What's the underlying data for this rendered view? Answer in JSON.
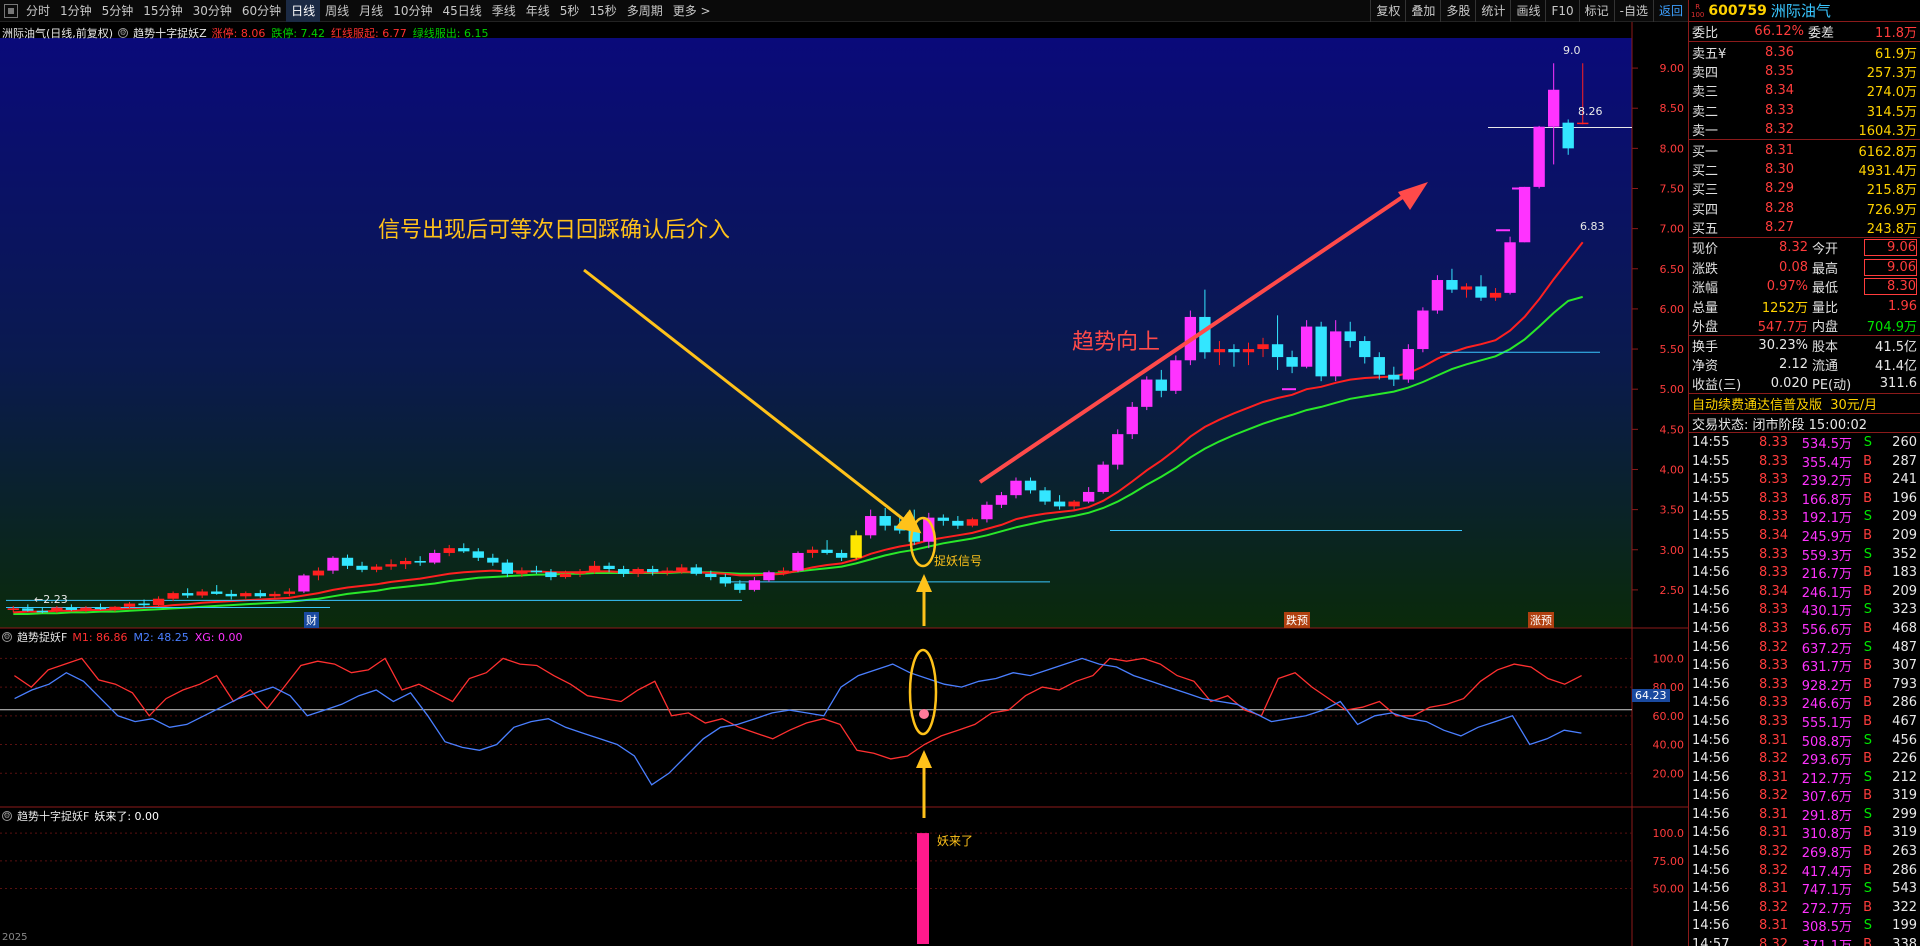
{
  "toolbar": {
    "periods": [
      "分时",
      "1分钟",
      "5分钟",
      "15分钟",
      "30分钟",
      "60分钟",
      "日线",
      "周线",
      "月线",
      "10分钟",
      "45日线",
      "季线",
      "年线",
      "5秒",
      "15秒",
      "多周期",
      "更多 >"
    ],
    "active_period": "日线",
    "right_buttons": [
      "复权",
      "叠加",
      "多股",
      "统计",
      "画线",
      "F10",
      "标记",
      "-自选",
      "返回"
    ]
  },
  "main_legend": {
    "title": "洲际油气(日线,前复权)",
    "indicator": "趋势十字捉妖Z",
    "items": [
      {
        "label": "涨停: 8.06",
        "color": "#ff3030"
      },
      {
        "label": "跌停: 7.42",
        "color": "#00d000"
      },
      {
        "label": "红线服起: 6.77",
        "color": "#ff3030"
      },
      {
        "label": "绿线服出: 6.15",
        "color": "#00d000"
      }
    ]
  },
  "sub1_legend": {
    "indicator": "趋势捉妖F",
    "items": [
      {
        "label": "M1: 86.86",
        "color": "#ff3030"
      },
      {
        "label": "M2: 48.25",
        "color": "#4a7fff"
      },
      {
        "label": "XG: 0.00",
        "color": "#ff33ff"
      }
    ]
  },
  "sub2_legend": {
    "indicator": "趋势十字捉妖F",
    "items": [
      {
        "label": "妖来了: 0.00",
        "color": "#ffffff"
      }
    ]
  },
  "annotations": {
    "entry_hint": "信号出现后可等次日回踩确认后介入",
    "trend_up": "趋势向上",
    "signal_label": "捉妖信号",
    "yao_lai_le": "妖来了",
    "low_label": "←2.23",
    "high_label": "9.0",
    "red_line_end": "6.83",
    "cur_price_label": "8.26",
    "sub1_cursor_value": "64.23",
    "event_cai": "财",
    "event_dieting": "跌预",
    "event_zhangting": "涨预",
    "x_axis_label": "2025"
  },
  "axes": {
    "price_ticks": [
      "9.00",
      "8.50",
      "8.00",
      "7.50",
      "7.00",
      "6.50",
      "6.00",
      "5.50",
      "5.00",
      "4.50",
      "4.00",
      "3.50",
      "3.00",
      "2.50"
    ],
    "sub1_ticks": [
      "100.0",
      "80.00",
      "60.00",
      "40.00",
      "20.00"
    ],
    "sub2_ticks": [
      "100.0",
      "75.00",
      "50.00"
    ]
  },
  "chart_data": {
    "type": "candlestick",
    "price_range": [
      2.1,
      9.3
    ],
    "ohlc": [
      [
        2.25,
        2.3,
        2.22,
        2.27
      ],
      [
        2.27,
        2.32,
        2.23,
        2.24
      ],
      [
        2.24,
        2.28,
        2.21,
        2.23
      ],
      [
        2.23,
        2.3,
        2.21,
        2.28
      ],
      [
        2.28,
        2.32,
        2.24,
        2.25
      ],
      [
        2.25,
        2.3,
        2.22,
        2.28
      ],
      [
        2.28,
        2.33,
        2.25,
        2.26
      ],
      [
        2.26,
        2.3,
        2.23,
        2.29
      ],
      [
        2.29,
        2.35,
        2.27,
        2.33
      ],
      [
        2.33,
        2.38,
        2.29,
        2.31
      ],
      [
        2.31,
        2.42,
        2.3,
        2.39
      ],
      [
        2.39,
        2.48,
        2.36,
        2.46
      ],
      [
        2.46,
        2.52,
        2.4,
        2.43
      ],
      [
        2.43,
        2.51,
        2.4,
        2.48
      ],
      [
        2.48,
        2.56,
        2.44,
        2.45
      ],
      [
        2.45,
        2.5,
        2.38,
        2.42
      ],
      [
        2.42,
        2.48,
        2.39,
        2.46
      ],
      [
        2.46,
        2.5,
        2.4,
        2.42
      ],
      [
        2.42,
        2.48,
        2.38,
        2.45
      ],
      [
        2.45,
        2.52,
        2.42,
        2.48
      ],
      [
        2.48,
        2.7,
        2.46,
        2.68
      ],
      [
        2.68,
        2.78,
        2.62,
        2.74
      ],
      [
        2.74,
        2.92,
        2.7,
        2.9
      ],
      [
        2.9,
        2.94,
        2.76,
        2.8
      ],
      [
        2.8,
        2.85,
        2.72,
        2.75
      ],
      [
        2.75,
        2.82,
        2.72,
        2.79
      ],
      [
        2.79,
        2.88,
        2.75,
        2.82
      ],
      [
        2.82,
        2.9,
        2.76,
        2.86
      ],
      [
        2.86,
        2.92,
        2.8,
        2.84
      ],
      [
        2.84,
        3.0,
        2.82,
        2.96
      ],
      [
        2.96,
        3.06,
        2.92,
        3.02
      ],
      [
        3.02,
        3.08,
        2.96,
        2.98
      ],
      [
        2.98,
        3.02,
        2.86,
        2.9
      ],
      [
        2.9,
        2.95,
        2.8,
        2.84
      ],
      [
        2.84,
        2.88,
        2.66,
        2.7
      ],
      [
        2.7,
        2.78,
        2.66,
        2.74
      ],
      [
        2.74,
        2.8,
        2.7,
        2.72
      ],
      [
        2.72,
        2.76,
        2.62,
        2.66
      ],
      [
        2.66,
        2.74,
        2.64,
        2.7
      ],
      [
        2.7,
        2.76,
        2.66,
        2.73
      ],
      [
        2.73,
        2.86,
        2.7,
        2.8
      ],
      [
        2.8,
        2.84,
        2.72,
        2.76
      ],
      [
        2.76,
        2.8,
        2.66,
        2.7
      ],
      [
        2.7,
        2.78,
        2.66,
        2.76
      ],
      [
        2.76,
        2.8,
        2.68,
        2.72
      ],
      [
        2.72,
        2.78,
        2.68,
        2.74
      ],
      [
        2.74,
        2.82,
        2.7,
        2.78
      ],
      [
        2.78,
        2.82,
        2.68,
        2.7
      ],
      [
        2.7,
        2.74,
        2.62,
        2.66
      ],
      [
        2.66,
        2.7,
        2.54,
        2.58
      ],
      [
        2.58,
        2.62,
        2.46,
        2.5
      ],
      [
        2.5,
        2.66,
        2.48,
        2.62
      ],
      [
        2.62,
        2.74,
        2.6,
        2.72
      ],
      [
        2.72,
        2.78,
        2.68,
        2.74
      ],
      [
        2.74,
        2.98,
        2.72,
        2.96
      ],
      [
        2.96,
        3.04,
        2.9,
        3.0
      ],
      [
        3.0,
        3.12,
        2.94,
        2.96
      ],
      [
        2.96,
        3.0,
        2.86,
        2.9
      ],
      [
        2.9,
        3.24,
        2.88,
        3.18
      ],
      [
        3.18,
        3.5,
        3.14,
        3.42
      ],
      [
        3.42,
        3.52,
        3.24,
        3.3
      ],
      [
        3.3,
        3.4,
        3.2,
        3.24
      ],
      [
        3.24,
        3.5,
        3.06,
        3.1
      ],
      [
        3.1,
        3.46,
        3.02,
        3.4
      ],
      [
        3.4,
        3.44,
        3.3,
        3.36
      ],
      [
        3.36,
        3.42,
        3.26,
        3.3
      ],
      [
        3.3,
        3.4,
        3.28,
        3.38
      ],
      [
        3.38,
        3.6,
        3.34,
        3.56
      ],
      [
        3.56,
        3.72,
        3.52,
        3.68
      ],
      [
        3.68,
        3.9,
        3.64,
        3.86
      ],
      [
        3.86,
        3.9,
        3.7,
        3.74
      ],
      [
        3.74,
        3.78,
        3.56,
        3.6
      ],
      [
        3.6,
        3.68,
        3.5,
        3.54
      ],
      [
        3.54,
        3.62,
        3.5,
        3.6
      ],
      [
        3.6,
        3.78,
        3.58,
        3.72
      ],
      [
        3.72,
        4.1,
        3.7,
        4.06
      ],
      [
        4.06,
        4.5,
        4.0,
        4.44
      ],
      [
        4.44,
        4.84,
        4.38,
        4.78
      ],
      [
        4.78,
        5.16,
        4.74,
        5.12
      ],
      [
        5.12,
        5.24,
        4.9,
        4.98
      ],
      [
        4.98,
        5.42,
        4.94,
        5.36
      ],
      [
        5.36,
        5.98,
        5.3,
        5.9
      ],
      [
        5.9,
        6.24,
        5.38,
        5.46
      ],
      [
        5.46,
        5.6,
        5.3,
        5.5
      ],
      [
        5.5,
        5.56,
        5.28,
        5.46
      ],
      [
        5.46,
        5.58,
        5.3,
        5.5
      ],
      [
        5.5,
        5.64,
        5.4,
        5.56
      ],
      [
        5.56,
        5.92,
        5.24,
        5.4
      ],
      [
        5.4,
        5.48,
        5.2,
        5.28
      ],
      [
        5.28,
        5.86,
        5.26,
        5.78
      ],
      [
        5.78,
        5.84,
        5.1,
        5.16
      ],
      [
        5.16,
        5.86,
        5.1,
        5.72
      ],
      [
        5.72,
        5.84,
        5.52,
        5.6
      ],
      [
        5.6,
        5.66,
        5.32,
        5.4
      ],
      [
        5.4,
        5.46,
        5.12,
        5.18
      ],
      [
        5.18,
        5.28,
        5.04,
        5.12
      ],
      [
        5.12,
        5.56,
        5.08,
        5.5
      ],
      [
        5.5,
        6.02,
        5.46,
        5.98
      ],
      [
        5.98,
        6.42,
        5.94,
        6.36
      ],
      [
        6.36,
        6.5,
        6.2,
        6.24
      ],
      [
        6.24,
        6.32,
        6.14,
        6.28
      ],
      [
        6.28,
        6.42,
        6.1,
        6.14
      ],
      [
        6.14,
        6.26,
        6.1,
        6.2
      ],
      [
        6.2,
        6.9,
        6.18,
        6.83
      ],
      [
        6.83,
        7.52,
        6.83,
        7.52
      ],
      [
        7.52,
        8.28,
        7.5,
        8.27
      ],
      [
        8.27,
        9.06,
        7.8,
        8.73
      ],
      [
        8.32,
        8.36,
        7.92,
        8.0
      ],
      [
        8.32,
        9.06,
        8.3,
        8.32
      ]
    ],
    "red_line": [
      2.22,
      2.23,
      2.23,
      2.24,
      2.24,
      2.25,
      2.25,
      2.26,
      2.27,
      2.28,
      2.29,
      2.31,
      2.32,
      2.34,
      2.35,
      2.36,
      2.37,
      2.38,
      2.39,
      2.4,
      2.43,
      2.46,
      2.5,
      2.53,
      2.55,
      2.57,
      2.6,
      2.62,
      2.64,
      2.67,
      2.7,
      2.72,
      2.73,
      2.74,
      2.73,
      2.73,
      2.73,
      2.72,
      2.72,
      2.72,
      2.73,
      2.73,
      2.72,
      2.72,
      2.72,
      2.72,
      2.73,
      2.72,
      2.71,
      2.7,
      2.68,
      2.68,
      2.69,
      2.7,
      2.74,
      2.78,
      2.81,
      2.83,
      2.88,
      2.95,
      3.0,
      3.04,
      3.07,
      3.12,
      3.15,
      3.18,
      3.21,
      3.26,
      3.31,
      3.38,
      3.42,
      3.45,
      3.47,
      3.49,
      3.53,
      3.61,
      3.72,
      3.85,
      3.99,
      4.11,
      4.25,
      4.41,
      4.53,
      4.62,
      4.7,
      4.77,
      4.84,
      4.89,
      4.93,
      5.0,
      5.03,
      5.08,
      5.12,
      5.14,
      5.15,
      5.16,
      5.2,
      5.28,
      5.38,
      5.46,
      5.52,
      5.56,
      5.61,
      5.73,
      5.9,
      6.12,
      6.37,
      6.6,
      6.83
    ],
    "green_line": [
      2.2,
      2.2,
      2.21,
      2.21,
      2.22,
      2.22,
      2.23,
      2.23,
      2.24,
      2.25,
      2.26,
      2.27,
      2.28,
      2.29,
      2.3,
      2.31,
      2.32,
      2.33,
      2.34,
      2.35,
      2.37,
      2.39,
      2.42,
      2.45,
      2.47,
      2.49,
      2.52,
      2.54,
      2.56,
      2.58,
      2.61,
      2.63,
      2.65,
      2.66,
      2.67,
      2.68,
      2.69,
      2.69,
      2.7,
      2.7,
      2.71,
      2.71,
      2.71,
      2.71,
      2.71,
      2.71,
      2.72,
      2.72,
      2.72,
      2.71,
      2.7,
      2.7,
      2.7,
      2.71,
      2.73,
      2.75,
      2.77,
      2.79,
      2.83,
      2.88,
      2.93,
      2.97,
      3.0,
      3.04,
      3.08,
      3.11,
      3.14,
      3.18,
      3.23,
      3.28,
      3.32,
      3.36,
      3.39,
      3.42,
      3.46,
      3.52,
      3.6,
      3.7,
      3.81,
      3.91,
      4.02,
      4.15,
      4.26,
      4.35,
      4.43,
      4.5,
      4.57,
      4.63,
      4.68,
      4.74,
      4.78,
      4.83,
      4.88,
      4.91,
      4.94,
      4.97,
      5.02,
      5.09,
      5.17,
      5.25,
      5.31,
      5.36,
      5.41,
      5.5,
      5.62,
      5.78,
      5.95,
      6.1,
      6.15
    ],
    "m1": [
      88,
      80,
      92,
      96,
      100,
      85,
      82,
      76,
      60,
      72,
      78,
      82,
      88,
      70,
      78,
      65,
      80,
      95,
      98,
      96,
      90,
      92,
      100,
      78,
      82,
      76,
      70,
      86,
      90,
      100,
      96,
      95,
      88,
      82,
      74,
      72,
      70,
      78,
      84,
      60,
      62,
      55,
      58,
      52,
      48,
      44,
      50,
      55,
      58,
      54,
      36,
      34,
      30,
      32,
      40,
      46,
      50,
      54,
      62,
      64,
      74,
      80,
      78,
      84,
      88,
      100,
      98,
      100,
      96,
      88,
      84,
      70,
      74,
      64,
      60,
      86,
      90,
      80,
      72,
      64,
      66,
      70,
      60,
      60,
      66,
      68,
      72,
      84,
      92,
      96,
      94,
      86,
      82,
      88
    ],
    "m2": [
      72,
      78,
      82,
      90,
      84,
      72,
      60,
      56,
      58,
      52,
      54,
      60,
      66,
      72,
      76,
      80,
      74,
      60,
      64,
      68,
      74,
      78,
      70,
      76,
      60,
      42,
      38,
      36,
      40,
      52,
      56,
      58,
      52,
      48,
      44,
      40,
      32,
      12,
      20,
      32,
      44,
      52,
      54,
      58,
      62,
      64,
      62,
      60,
      80,
      88,
      92,
      96,
      90,
      86,
      82,
      80,
      84,
      86,
      90,
      88,
      92,
      96,
      100,
      96,
      94,
      88,
      84,
      80,
      76,
      72,
      70,
      68,
      62,
      56,
      58,
      60,
      64,
      70,
      54,
      60,
      62,
      58,
      56,
      50,
      46,
      52,
      56,
      60,
      40,
      44,
      50,
      48
    ],
    "yao_bar_value": 100
  }
}
